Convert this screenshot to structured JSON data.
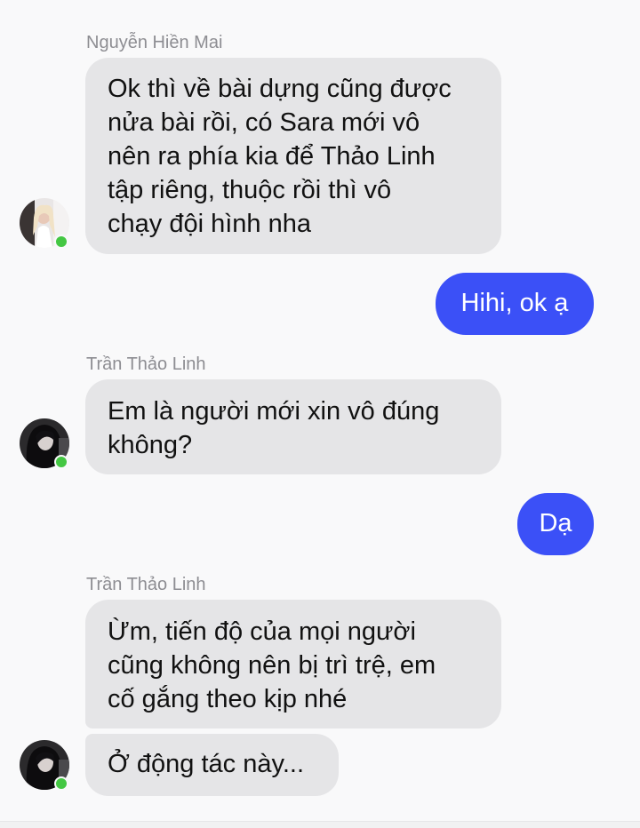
{
  "conversation": {
    "messages": [
      {
        "sender": "Nguyễn Hiền Mai",
        "direction": "incoming",
        "text": "Ok thì về bài dựng cũng được\nnửa bài rồi, có Sara mới vô\nnên ra phía kia để Thảo Linh\ntập riêng, thuộc rồi thì vô\nchạy đội hình nha",
        "avatar_icon": "user-avatar-light-icon",
        "online": true
      },
      {
        "direction": "outgoing",
        "text": "Hihi, ok ạ"
      },
      {
        "sender": "Trần Thảo Linh",
        "direction": "incoming",
        "text": "Em là người mới xin vô đúng\nkhông?",
        "avatar_icon": "user-avatar-dark-icon",
        "online": true
      },
      {
        "direction": "outgoing",
        "text": "Dạ"
      },
      {
        "sender": "Trần Thảo Linh",
        "direction": "incoming",
        "text": "Ừm, tiến độ của mọi người\ncũng không nên bị trì trệ, em\ncố gắng theo kịp nhé"
      },
      {
        "direction": "incoming",
        "text": "Ở động tác này...",
        "avatar_icon": "user-avatar-dark-icon",
        "online": true
      }
    ]
  },
  "colors": {
    "background": "#f9f9fa",
    "incoming_bubble": "#e5e5e7",
    "outgoing_bubble": "#3b50f7",
    "sender_name": "#8d8d92",
    "online_indicator": "#44c743"
  }
}
